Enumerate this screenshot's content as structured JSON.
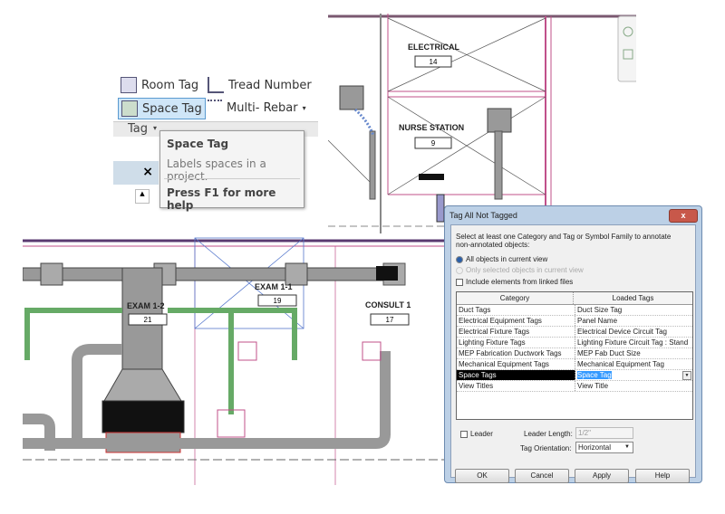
{
  "plan_top": {
    "rooms": [
      {
        "name": "ELECTRICAL",
        "number": "14"
      },
      {
        "name": "NURSE STATION",
        "number": "9"
      }
    ]
  },
  "plan_bottom": {
    "rooms": [
      {
        "name": "EXAM 1-2",
        "number": "21"
      },
      {
        "name": "EXAM 1-1",
        "number": "19"
      },
      {
        "name": "CONSULT 1",
        "number": "17"
      }
    ]
  },
  "ribbon": {
    "buttons": [
      {
        "label": "Room Tag",
        "icon": "room-tag-icon"
      },
      {
        "label": "Tread Number",
        "icon": "tread-number-icon"
      },
      {
        "label": "Space Tag",
        "icon": "space-tag-icon",
        "active": true
      },
      {
        "label": "Multi- Rebar",
        "icon": "multi-rebar-icon"
      }
    ],
    "panel_label": "Tag",
    "close_glyph": "×",
    "tooltip": {
      "title": "Space Tag",
      "description": "Labels spaces in a project.",
      "help": "Press F1 for more help"
    }
  },
  "dialog": {
    "title": "Tag All Not Tagged",
    "instructions": "Select at least one Category and Tag or Symbol Family to annotate non-annotated objects:",
    "radio_all": "All objects in current view",
    "radio_selected": "Only selected objects in current view",
    "checkbox_linked": "Include elements from linked files",
    "columns": [
      "Category",
      "Loaded Tags"
    ],
    "rows": [
      {
        "category": "Duct Tags",
        "tag": "Duct Size Tag"
      },
      {
        "category": "Electrical Equipment Tags",
        "tag": "Panel Name"
      },
      {
        "category": "Electrical Fixture Tags",
        "tag": "Electrical Device Circuit Tag"
      },
      {
        "category": "Lighting Fixture Tags",
        "tag": "Lighting Fixture Circuit Tag : Stand"
      },
      {
        "category": "MEP Fabrication Ductwork Tags",
        "tag": "MEP Fab Duct Size"
      },
      {
        "category": "Mechanical Equipment Tags",
        "tag": "Mechanical Equipment Tag"
      },
      {
        "category": "Space Tags",
        "tag": "Space Tag",
        "selected": true
      },
      {
        "category": "View Titles",
        "tag": "View Title"
      }
    ],
    "leader_label": "Leader",
    "leader_length_label": "Leader Length:",
    "leader_length_value": "1/2\"",
    "orientation_label": "Tag Orientation:",
    "orientation_value": "Horizontal",
    "buttons": {
      "ok": "OK",
      "cancel": "Cancel",
      "apply": "Apply",
      "help": "Help"
    },
    "colors": {
      "selected_row": "#000000",
      "selected_tag": "#3399ff"
    }
  }
}
